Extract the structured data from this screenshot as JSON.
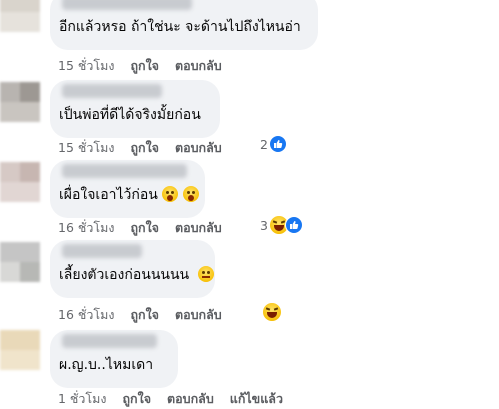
{
  "comments": [
    {
      "author": "",
      "text": "อีกแล้วหรอ ถ้าใช่นะ จะด้านไปถึงไหนอ่า",
      "emoji": [],
      "time": "15 ชั่วโมง",
      "like": "ถูกใจ",
      "reply": "ตอบกลับ",
      "edit": "",
      "reaction_count": "",
      "reactions": []
    },
    {
      "author": "",
      "text": "เป็นพ่อที่ดีได้จริงมั้ยก่อน",
      "emoji": [],
      "time": "15 ชั่วโมง",
      "like": "ถูกใจ",
      "reply": "ตอบกลับ",
      "edit": "",
      "reaction_count": "2",
      "reactions": [
        "like-icon"
      ]
    },
    {
      "author": "",
      "text": "เผื่อใจเอาไว้ก่อน",
      "emoji": [
        "gasp-emoji",
        "gasp-emoji"
      ],
      "time": "16 ชั่วโมง",
      "like": "ถูกใจ",
      "reply": "ตอบกลับ",
      "edit": "",
      "reaction_count": "3",
      "reactions": [
        "haha-icon",
        "like-icon"
      ]
    },
    {
      "author": "",
      "text": "เลี้ยงตัวเองก่อนนนนน",
      "emoji": [
        "neutral-emoji"
      ],
      "time": "16 ชั่วโมง",
      "like": "ถูกใจ",
      "reply": "ตอบกลับ",
      "edit": "",
      "reaction_count": "",
      "reactions": [
        "haha-icon"
      ]
    },
    {
      "author": "",
      "text": "ผ.ญ.บ..ไหมเดา",
      "emoji": [],
      "time": "1 ชั่วโมง",
      "like": "ถูกใจ",
      "reply": "ตอบกลับ",
      "edit": "แก้ไขแล้ว",
      "reaction_count": "",
      "reactions": []
    }
  ],
  "colors": {
    "bubble": "#f0f2f5",
    "meta_text": "#65676b",
    "like_blue": "#1877f2"
  }
}
